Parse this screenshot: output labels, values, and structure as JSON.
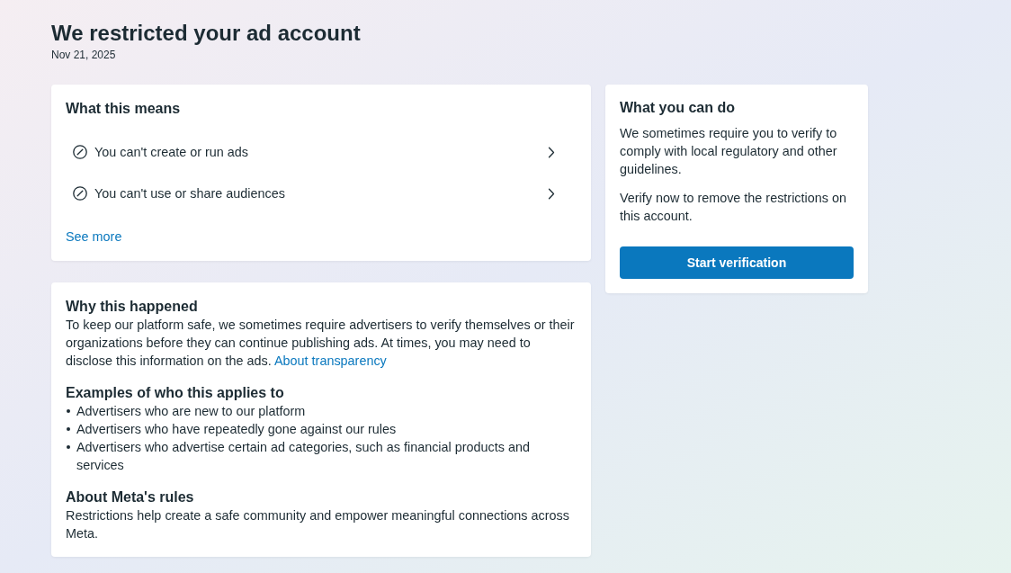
{
  "page": {
    "title": "We restricted your ad account",
    "date": "Nov 21, 2025"
  },
  "what_this_means": {
    "heading": "What this means",
    "items": [
      {
        "text": "You can't create or run ads"
      },
      {
        "text": "You can't use or share audiences"
      }
    ],
    "link": "See more"
  },
  "why_this_happened": {
    "sections": [
      {
        "kind": "paragraph",
        "heading": "Why this happened",
        "text": "To keep our platform safe, we sometimes require advertisers to verify themselves or their organizations before they can continue publishing ads. At times, you may need to disclose this information on the ads.",
        "link": "About transparency"
      },
      {
        "kind": "list",
        "heading": "Examples of who this applies to",
        "items": [
          "Advertisers who are new to our platform",
          "Advertisers who have repeatedly gone against our rules",
          "Advertisers who advertise certain ad categories, such as financial products and services"
        ]
      },
      {
        "kind": "paragraph",
        "heading": "About Meta's rules",
        "text": "Restrictions help create a safe community and empower meaningful connections across Meta."
      }
    ]
  },
  "what_you_can_do": {
    "heading": "What you can do",
    "paragraphs": [
      "We sometimes require you to verify to comply with local regulatory and other guidelines.",
      "Verify now to remove the restrictions on this account."
    ],
    "button": "Start verification"
  }
}
